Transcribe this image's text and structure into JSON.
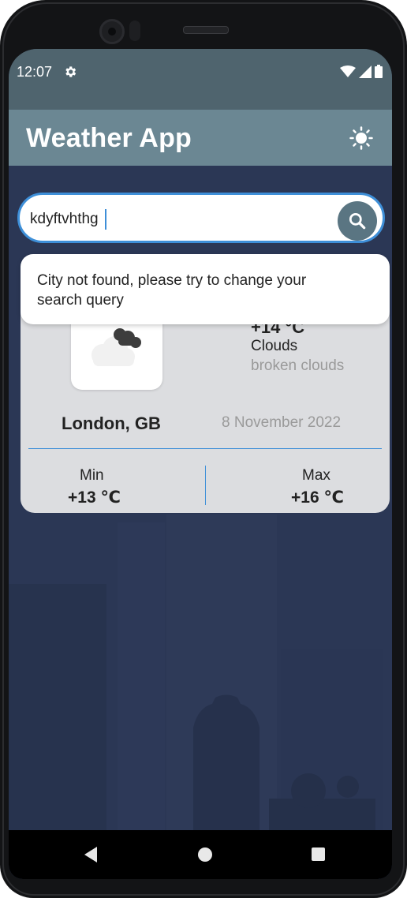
{
  "status_bar": {
    "time": "12:07"
  },
  "app_bar": {
    "title": "Weather App"
  },
  "search": {
    "value": "kdyftvhthg",
    "placeholder": ""
  },
  "toast": {
    "message": "City not found, please try to change your search query"
  },
  "weather": {
    "temperature": "+14 °C",
    "condition": "Clouds",
    "description": "broken clouds",
    "city": "London, GB",
    "date": "8 November 2022",
    "min_label": "Min",
    "min_value": "+13 ℃",
    "max_label": "Max",
    "max_value": "+16 ℃"
  },
  "icons": {
    "settings": "gear-icon",
    "wifi": "wifi-icon",
    "signal": "signal-icon",
    "battery": "battery-icon",
    "theme": "sun-icon",
    "search": "search-icon",
    "weather": "broken-clouds-icon",
    "back": "back-icon",
    "home": "home-icon",
    "recent": "recent-apps-icon"
  },
  "colors": {
    "status_bar": "#4f646e",
    "app_bar": "#6b8793",
    "background": "#2b3755",
    "accent": "#3e8fd8",
    "card": "#dcdde0"
  }
}
